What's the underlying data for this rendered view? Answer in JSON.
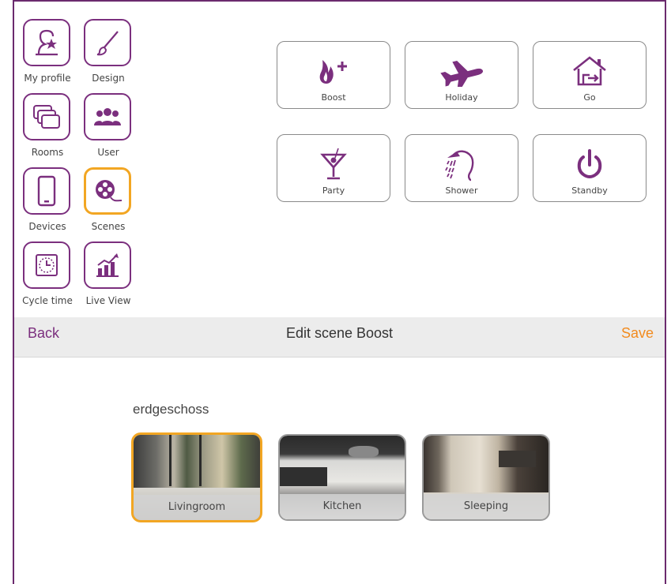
{
  "sidebar": {
    "items": [
      {
        "label": "My profile",
        "icon": "profile-star-icon"
      },
      {
        "label": "Design",
        "icon": "brush-icon"
      },
      {
        "label": "Rooms",
        "icon": "rooms-icon"
      },
      {
        "label": "User",
        "icon": "users-icon"
      },
      {
        "label": "Devices",
        "icon": "phone-icon"
      },
      {
        "label": "Scenes",
        "icon": "film-reel-icon",
        "active": true
      },
      {
        "label": "Cycle time",
        "icon": "clock-icon"
      },
      {
        "label": "Live View",
        "icon": "chart-icon"
      }
    ]
  },
  "scenes": [
    {
      "label": "Boost",
      "icon": "flame-plus-icon"
    },
    {
      "label": "Holiday",
      "icon": "airplane-icon"
    },
    {
      "label": "Go",
      "icon": "house-exit-icon"
    },
    {
      "label": "Party",
      "icon": "cocktail-icon"
    },
    {
      "label": "Shower",
      "icon": "shower-icon"
    },
    {
      "label": "Standby",
      "icon": "power-icon"
    }
  ],
  "toolbar": {
    "back_label": "Back",
    "title": "Edit scene Boost",
    "save_label": "Save"
  },
  "floor": {
    "name": "erdgeschoss",
    "rooms": [
      {
        "label": "Livingroom",
        "selected": true
      },
      {
        "label": "Kitchen",
        "selected": false
      },
      {
        "label": "Sleeping",
        "selected": false
      }
    ]
  },
  "colors": {
    "brand": "#7b2f7e",
    "accent": "#f2a623",
    "save": "#f28b1e"
  }
}
